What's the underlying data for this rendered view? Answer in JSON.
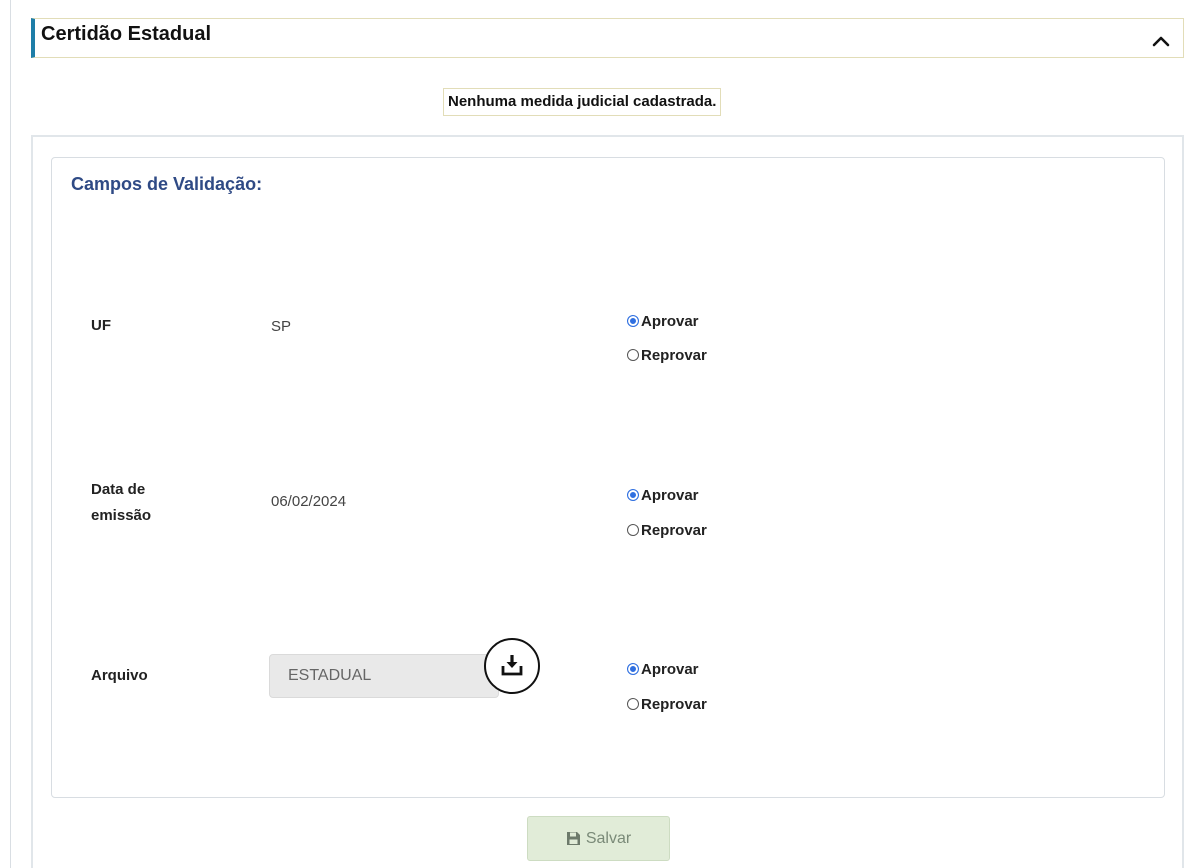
{
  "section": {
    "title": "Certidão Estadual",
    "collapse_icon": "chevron-up-icon"
  },
  "notice": "Nenhuma medida judicial cadastrada.",
  "validation": {
    "title": "Campos de Validação:",
    "fields": [
      {
        "label": "UF",
        "value": "SP",
        "approve": "Aprovar",
        "reject": "Reprovar",
        "selected": "approve"
      },
      {
        "label_line1": "Data de",
        "label_line2": "emissão",
        "value": "06/02/2024",
        "approve": "Aprovar",
        "reject": "Reprovar",
        "selected": "approve"
      },
      {
        "label": "Arquivo",
        "file_value": "ESTADUAL",
        "download_icon": "download-icon",
        "approve": "Aprovar",
        "reject": "Reprovar",
        "selected": "approve"
      }
    ]
  },
  "actions": {
    "save_label": "Salvar",
    "save_icon": "floppy-disk-icon"
  },
  "colors": {
    "accent": "#1e7ea8",
    "title_blue": "#2f4a85",
    "radio_selected": "#2f6fe0",
    "save_bg": "#e1ecd8"
  }
}
